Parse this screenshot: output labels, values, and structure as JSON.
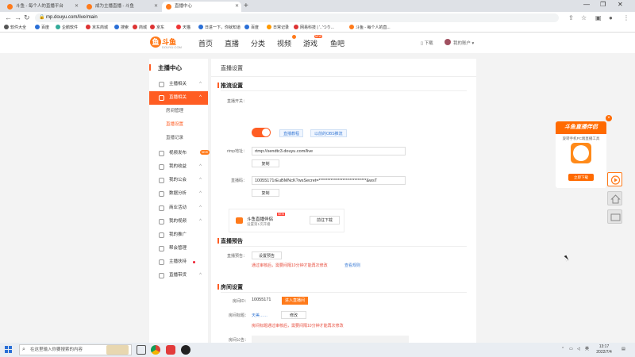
{
  "browser": {
    "tabs": [
      {
        "title": "斗鱼 - 每个人的直播平台",
        "active": false
      },
      {
        "title": "成为主播直播 - 斗鱼",
        "active": false
      },
      {
        "title": "直播中心",
        "active": true
      }
    ],
    "new_tab": "+",
    "url": "mp.douyu.com/live/main",
    "bookmarks": [
      "软件大全",
      "百度",
      "企鹅软件",
      "京东商城",
      "搜索",
      "商城",
      "京东",
      "天猫",
      "日进一下，你就知道",
      "百度",
      "日常记录",
      "网易科技 | '..'つり...",
      "斗鱼 - 每个人的直..."
    ]
  },
  "header": {
    "logo_text": "斗鱼",
    "logo_sub": "DOUYU.COM",
    "nav": [
      "首页",
      "直播",
      "分类",
      "视频",
      "游戏",
      "鱼吧"
    ],
    "video_badge": "",
    "game_badge": "NEW",
    "download": "下载",
    "username": "我的账户"
  },
  "sidebar": {
    "title": "主播中心",
    "items": [
      {
        "label": "主播相关",
        "chev": "^"
      },
      {
        "label": "直播相关",
        "chev": "^",
        "active": true
      },
      {
        "label": "房间管理",
        "sub": true
      },
      {
        "label": "直播设置",
        "sub": true,
        "current": true
      },
      {
        "label": "直播记录",
        "sub": true
      },
      {
        "label": "视频发布",
        "chev": "",
        "badge": "NEW"
      },
      {
        "label": "我的收益",
        "chev": "^"
      },
      {
        "label": "我的公会",
        "chev": "^"
      },
      {
        "label": "数据分析",
        "chev": "^"
      },
      {
        "label": "商业活动",
        "chev": "^"
      },
      {
        "label": "我的视频",
        "chev": "^"
      },
      {
        "label": "我的推广",
        "chev": ""
      },
      {
        "label": "帮会管理",
        "chev": ""
      },
      {
        "label": "主播扶持",
        "chev": "",
        "dot": true
      },
      {
        "label": "直播带货",
        "chev": "^"
      }
    ]
  },
  "main": {
    "title": "直播设置",
    "stream": {
      "section_title": "推流设置",
      "switch_label": "直播开关：",
      "link_tutorial": "直播教程",
      "link_obs": "以前的OBS推流",
      "rtmp_label": "rtmp地址：",
      "rtmp_value": "rtmp://sendtc3.douyu.com/live",
      "copy1": "复制",
      "code_label": "直播码：",
      "code_value": "10055171rEuBMNcK?wsSecret=****************************&wsT",
      "copy2": "复制",
      "promo_title": "斗鱼直播伴侣",
      "promo_sub": "设置第1次开播",
      "promo_new": "NEW",
      "promo_btn": "前往下载"
    },
    "notice": {
      "section_title": "直播预告",
      "label": "直播预告：",
      "btn": "设置预告",
      "red": "通过审核后，需要间隔10分钟才能再次修改",
      "link": "查看规则"
    },
    "room": {
      "section_title": "房间设置",
      "id_label": "房间ID：",
      "id_value": "10055171",
      "enter_btn": "进入直播间",
      "name_label": "房间标题：",
      "name_value": "天美……",
      "edit_btn": "修改",
      "red": "房间标题通过审核后，需要间隔10分钟才能再次修改",
      "bulletin_label": "房间公告："
    }
  },
  "ad": {
    "head": "斗鱼直播伴侣",
    "text": "旋转手机PC端直播工具",
    "btn": "立即下载",
    "close": "×"
  },
  "taskbar": {
    "search_placeholder": "在这里输入你要搜索的内容",
    "lang": "英",
    "time": "13:17",
    "date": "2022/7/4"
  }
}
